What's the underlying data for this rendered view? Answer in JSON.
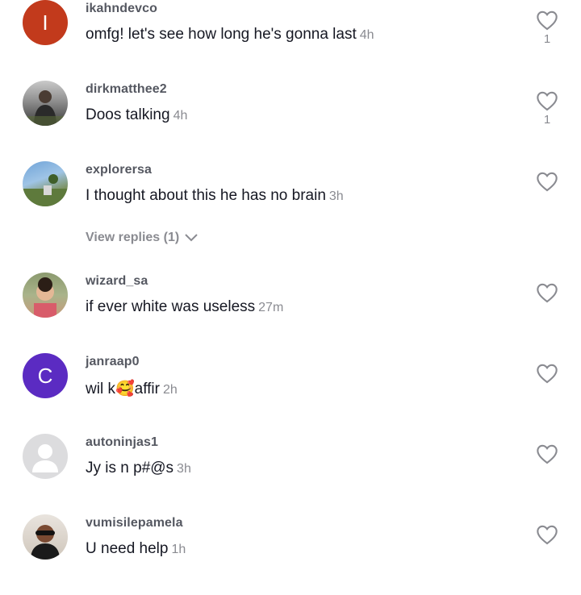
{
  "comments": [
    {
      "username": "ikahndevco",
      "text": "omfg! let's see how long he's gonna last",
      "time": "4h",
      "likes": "1",
      "avatar_letter": "I",
      "avatar_color": "#c23a1c"
    },
    {
      "username": "dirkmatthee2",
      "text": "Doos talking",
      "time": "4h",
      "likes": "1"
    },
    {
      "username": "explorersa",
      "text": "I thought about this he has no brain",
      "time": "3h",
      "likes": ""
    },
    {
      "username": "wizard_sa",
      "text": "if ever white was useless",
      "time": "27m",
      "likes": ""
    },
    {
      "username": "janraap0",
      "text": "wil k",
      "text_after": "affir",
      "emoji": "🥰",
      "time": "2h",
      "likes": "",
      "avatar_letter": "C",
      "avatar_color": "#5b2bc2"
    },
    {
      "username": "autoninjas1",
      "text": "Jy is n p#@s",
      "time": "3h",
      "likes": ""
    },
    {
      "username": "vumisilepamela",
      "text": "U need help",
      "time": "1h",
      "likes": ""
    }
  ],
  "view_replies": "View replies (1)"
}
